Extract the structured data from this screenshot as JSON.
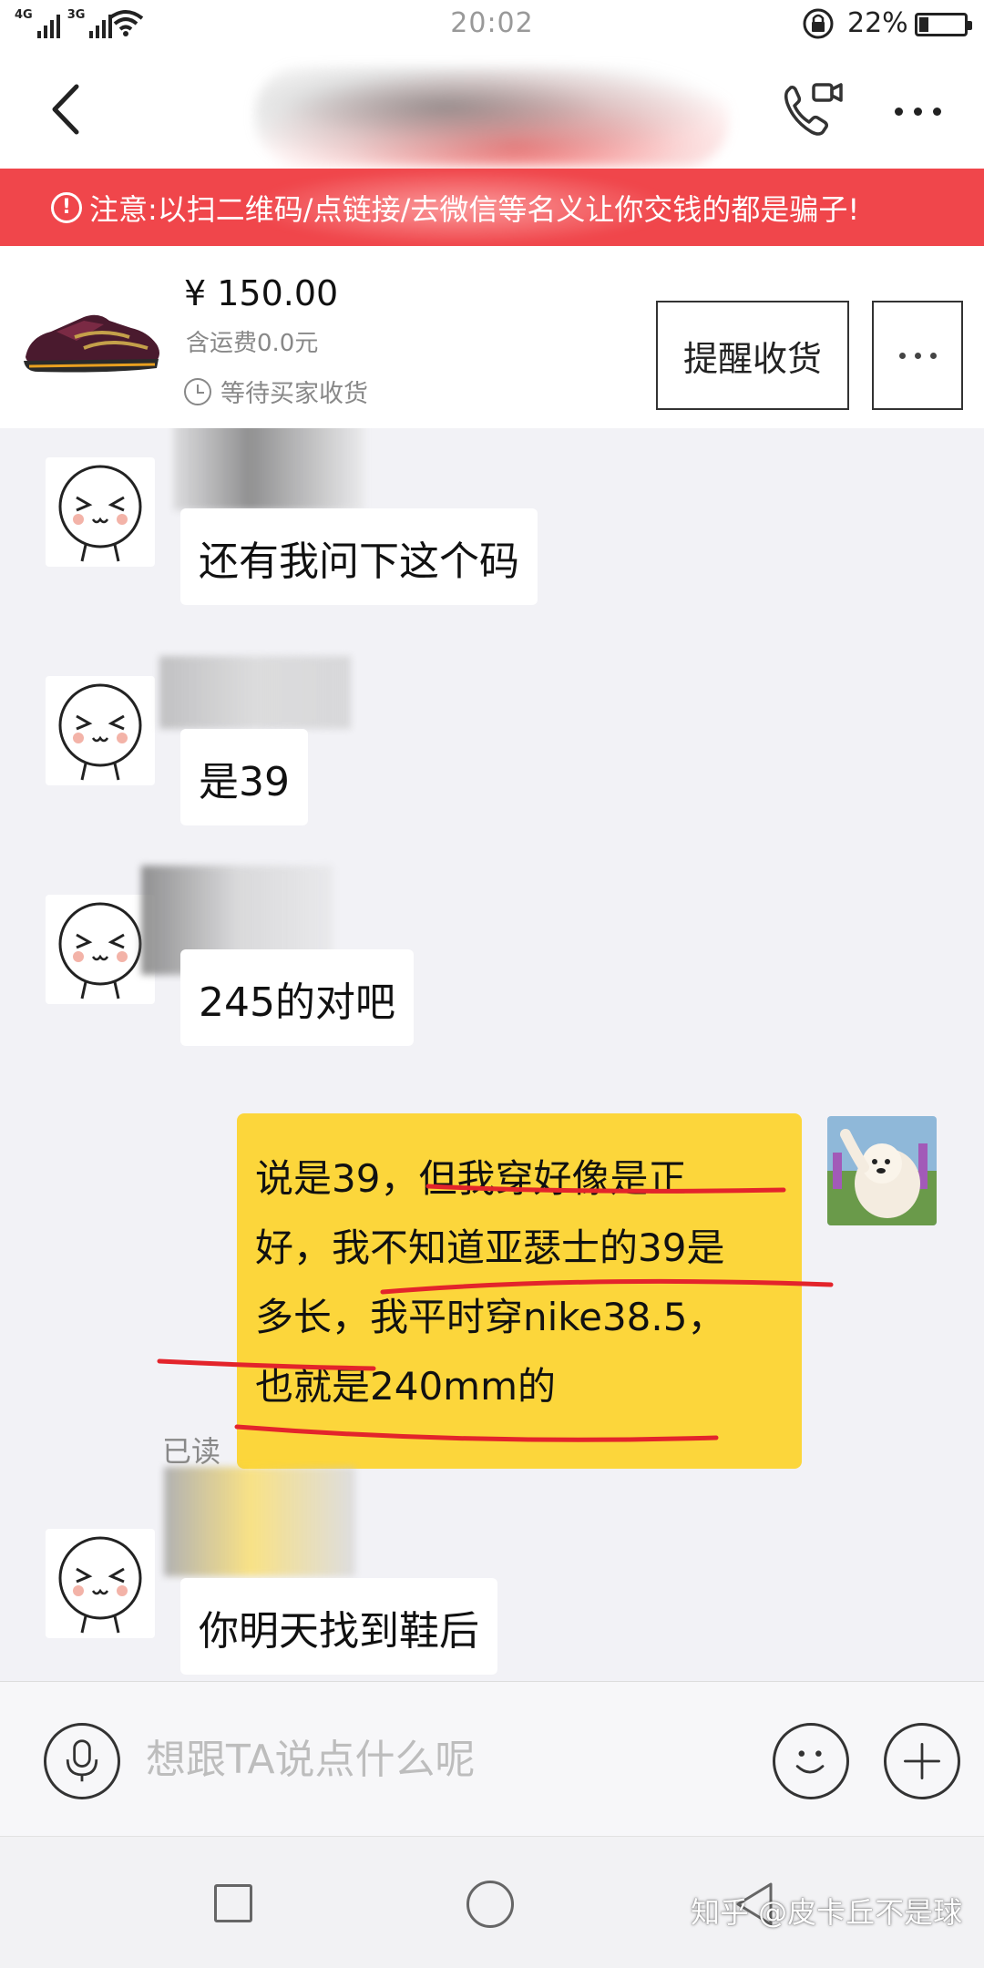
{
  "status_bar": {
    "network_left": "4G",
    "network_right": "3G",
    "time": "20:02",
    "battery": "22%"
  },
  "header": {
    "back_icon": "chevron-left-icon",
    "call_icon": "phone-video-icon",
    "more_icon": "more-dots-icon"
  },
  "warning": {
    "text": "注意:以扫二维码/点链接/去微信等名义让你交钱的都是骗子!"
  },
  "order": {
    "price": "¥ 150.00",
    "shipping": "含运费0.0元",
    "status": "等待买家收货",
    "remind_button": "提醒收货"
  },
  "messages": [
    {
      "side": "in",
      "text": "还有我问下这个码"
    },
    {
      "side": "in",
      "text": "是39"
    },
    {
      "side": "in",
      "text": "245的对吧"
    },
    {
      "side": "out",
      "lines": [
        "说是39，但我穿好像是正",
        "好，我不知道亚瑟士的39是",
        "多长，我平时穿nike38.5，",
        "也就是240mm的"
      ],
      "read_status": "已读"
    },
    {
      "side": "in",
      "text": "你明天找到鞋后"
    }
  ],
  "input": {
    "placeholder": "想跟TA说点什么呢"
  },
  "watermark": "知乎 @皮卡丘不是球",
  "colors": {
    "warning_bg": "#f0464b",
    "outgoing_bubble": "#fcd63b",
    "incoming_bubble": "#ffffff",
    "annotation_ink": "#e3242b"
  }
}
